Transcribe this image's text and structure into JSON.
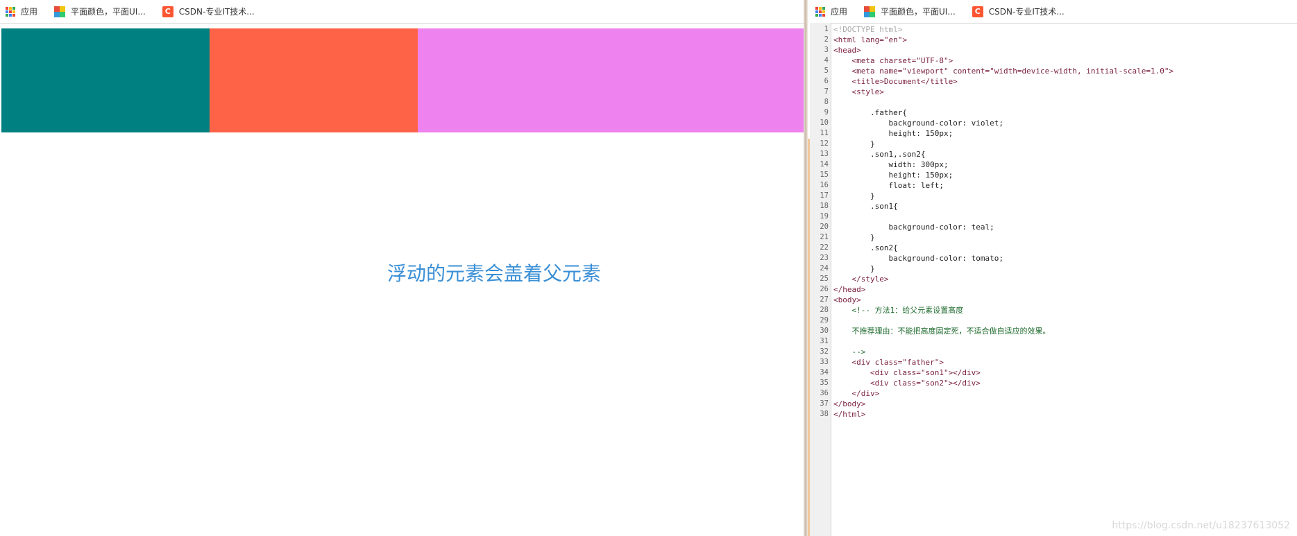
{
  "bookmarks_bar": {
    "apps_label": "应用",
    "items": [
      {
        "label": "平面颜色，平面UI...",
        "icon": "color-palette-icon"
      },
      {
        "label": "CSDN-专业IT技术...",
        "icon": "csdn-logo-icon",
        "icon_letter": "C"
      }
    ]
  },
  "preview": {
    "father_color": "#ee82ee",
    "son1_color": "#008080",
    "son2_color": "#ff6347",
    "annotation": "浮动的元素会盖着父元素",
    "annotation_color": "#3a8fd6"
  },
  "editor": {
    "lines": [
      {
        "n": "1",
        "text": "<!DOCTYPE html>",
        "color": "#a9a9a9"
      },
      {
        "n": "2",
        "text": "<html lang=\"en\">",
        "color": "#7a1f3d"
      },
      {
        "n": "3",
        "text": "<head>",
        "color": "#7a1f3d"
      },
      {
        "n": "4",
        "text": "    <meta charset=\"UTF-8\">",
        "color": "#7a1f3d"
      },
      {
        "n": "5",
        "text": "    <meta name=\"viewport\" content=\"width=device-width, initial-scale=1.0\">",
        "color": "#7a1f3d"
      },
      {
        "n": "6",
        "text": "    <title>Document</title>",
        "color": "#7a1f3d"
      },
      {
        "n": "7",
        "text": "    <style>",
        "color": "#7a1f3d"
      },
      {
        "n": "8",
        "text": "",
        "color": "#222222"
      },
      {
        "n": "9",
        "text": "        .father{",
        "color": "#222222"
      },
      {
        "n": "10",
        "text": "            background-color: violet;",
        "color": "#222222"
      },
      {
        "n": "11",
        "text": "            height: 150px;",
        "color": "#222222"
      },
      {
        "n": "12",
        "text": "        }",
        "color": "#222222"
      },
      {
        "n": "13",
        "text": "        .son1,.son2{",
        "color": "#222222"
      },
      {
        "n": "14",
        "text": "            width: 300px;",
        "color": "#222222"
      },
      {
        "n": "15",
        "text": "            height: 150px;",
        "color": "#222222"
      },
      {
        "n": "16",
        "text": "            float: left;",
        "color": "#222222"
      },
      {
        "n": "17",
        "text": "        }",
        "color": "#222222"
      },
      {
        "n": "18",
        "text": "        .son1{",
        "color": "#222222"
      },
      {
        "n": "19",
        "text": "",
        "color": "#222222"
      },
      {
        "n": "20",
        "text": "            background-color: teal;",
        "color": "#222222"
      },
      {
        "n": "21",
        "text": "        }",
        "color": "#222222"
      },
      {
        "n": "22",
        "text": "        .son2{",
        "color": "#222222"
      },
      {
        "n": "23",
        "text": "            background-color: tomato;",
        "color": "#222222"
      },
      {
        "n": "24",
        "text": "        }",
        "color": "#222222"
      },
      {
        "n": "25",
        "text": "    </style>",
        "color": "#7a1f3d"
      },
      {
        "n": "26",
        "text": "</head>",
        "color": "#7a1f3d"
      },
      {
        "n": "27",
        "text": "<body>",
        "color": "#7a1f3d"
      },
      {
        "n": "28",
        "text": "    <!-- 方法1：给父元素设置高度",
        "color": "#1f6b2e"
      },
      {
        "n": "29",
        "text": "",
        "color": "#1f6b2e"
      },
      {
        "n": "30",
        "text": "    不推荐理由：不能把高度固定死，不适合做自适应的效果。",
        "color": "#1f6b2e"
      },
      {
        "n": "31",
        "text": "",
        "color": "#1f6b2e"
      },
      {
        "n": "32",
        "text": "    -->",
        "color": "#1f6b2e"
      },
      {
        "n": "33",
        "text": "    <div class=\"father\">",
        "color": "#7a1f3d"
      },
      {
        "n": "34",
        "text": "        <div class=\"son1\"></div>",
        "color": "#7a1f3d"
      },
      {
        "n": "35",
        "text": "        <div class=\"son2\"></div>",
        "color": "#7a1f3d"
      },
      {
        "n": "36",
        "text": "    </div>",
        "color": "#7a1f3d"
      },
      {
        "n": "37",
        "text": "</body>",
        "color": "#7a1f3d"
      },
      {
        "n": "38",
        "text": "</html>",
        "color": "#7a1f3d"
      }
    ]
  },
  "watermark": "https://blog.csdn.net/u18237613052"
}
